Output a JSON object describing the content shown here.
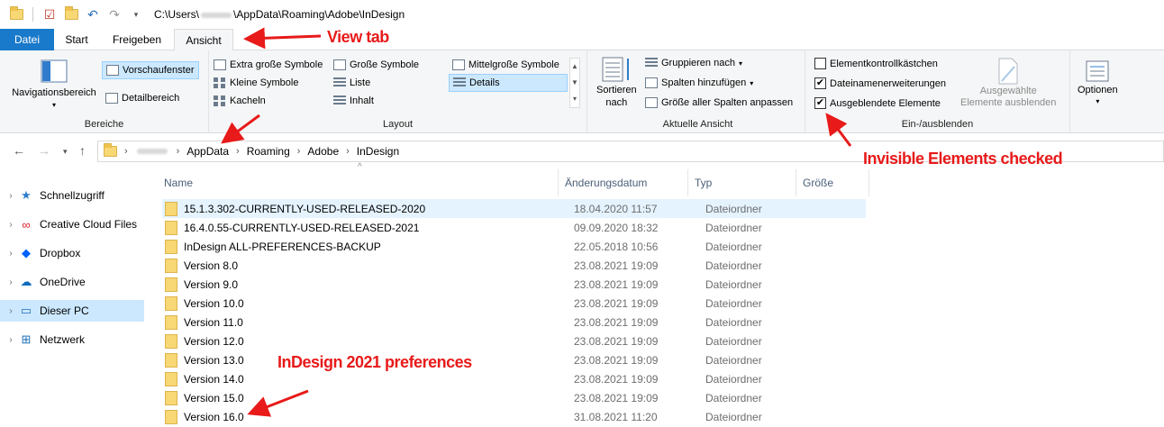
{
  "window": {
    "title_path_prefix": "C:\\Users\\",
    "title_path_suffix": "\\AppData\\Roaming\\Adobe\\InDesign"
  },
  "tabs": [
    {
      "label": "Datei"
    },
    {
      "label": "Start"
    },
    {
      "label": "Freigeben"
    },
    {
      "label": "Ansicht"
    }
  ],
  "ribbon": {
    "bereiche": {
      "label": "Bereiche",
      "nav_pane": "Navigationsbereich",
      "preview_pane": "Vorschaufenster",
      "details_pane": "Detailbereich"
    },
    "layout": {
      "label": "Layout",
      "items": [
        "Extra große Symbole",
        "Große Symbole",
        "Mittelgroße Symbole",
        "Kleine Symbole",
        "Liste",
        "Details",
        "Kacheln",
        "Inhalt"
      ]
    },
    "current_view": {
      "label": "Aktuelle Ansicht",
      "sort_by_line1": "Sortieren",
      "sort_by_line2": "nach",
      "group_by": "Gruppieren nach",
      "add_columns": "Spalten hinzufügen",
      "fit_columns": "Größe aller Spalten anpassen"
    },
    "show_hide": {
      "label": "Ein-/ausblenden",
      "item_checkboxes": "Elementkontrollkästchen",
      "file_extensions": "Dateinamenerweiterungen",
      "hidden_items": "Ausgeblendete Elemente",
      "hide_selected_line1": "Ausgewählte",
      "hide_selected_line2": "Elemente ausblenden",
      "check_item_checkboxes": false,
      "check_file_extensions": true,
      "check_hidden_items": true
    },
    "options": {
      "label": "Optionen"
    }
  },
  "address": {
    "crumbs": [
      "AppData",
      "Roaming",
      "Adobe",
      "InDesign"
    ]
  },
  "nav_pane": [
    {
      "label": "Schnellzugriff",
      "icon": "star-icon"
    },
    {
      "label": "Creative Cloud Files",
      "icon": "creative-cloud-icon"
    },
    {
      "label": "Dropbox",
      "icon": "dropbox-icon"
    },
    {
      "label": "OneDrive",
      "icon": "cloud-icon"
    },
    {
      "label": "Dieser PC",
      "icon": "monitor-icon",
      "selected": true
    },
    {
      "label": "Netzwerk",
      "icon": "network-icon"
    }
  ],
  "columns": [
    "Name",
    "Änderungsdatum",
    "Typ",
    "Größe"
  ],
  "files": [
    {
      "name": "15.1.3.302-CURRENTLY-USED-RELEASED-2020",
      "date": "18.04.2020 11:57",
      "type": "Dateiordner"
    },
    {
      "name": "16.4.0.55-CURRENTLY-USED-RELEASED-2021",
      "date": "09.09.2020 18:32",
      "type": "Dateiordner"
    },
    {
      "name": "InDesign ALL-PREFERENCES-BACKUP",
      "date": "22.05.2018 10:56",
      "type": "Dateiordner"
    },
    {
      "name": "Version 8.0",
      "date": "23.08.2021 19:09",
      "type": "Dateiordner"
    },
    {
      "name": "Version 9.0",
      "date": "23.08.2021 19:09",
      "type": "Dateiordner"
    },
    {
      "name": "Version 10.0",
      "date": "23.08.2021 19:09",
      "type": "Dateiordner"
    },
    {
      "name": "Version 11.0",
      "date": "23.08.2021 19:09",
      "type": "Dateiordner"
    },
    {
      "name": "Version 12.0",
      "date": "23.08.2021 19:09",
      "type": "Dateiordner"
    },
    {
      "name": "Version 13.0",
      "date": "23.08.2021 19:09",
      "type": "Dateiordner"
    },
    {
      "name": "Version 14.0",
      "date": "23.08.2021 19:09",
      "type": "Dateiordner"
    },
    {
      "name": "Version 15.0",
      "date": "23.08.2021 19:09",
      "type": "Dateiordner"
    },
    {
      "name": "Version 16.0",
      "date": "31.08.2021 11:20",
      "type": "Dateiordner"
    }
  ],
  "annotations": {
    "view_tab": "View tab",
    "invisible": "Invisible Elements checked",
    "prefs": "InDesign 2021 preferences",
    "color": "#e81a1a"
  },
  "colors": {
    "file_tab": "#1979ca",
    "selection": "#cce8ff",
    "row_hover": "#e5f3ff"
  }
}
